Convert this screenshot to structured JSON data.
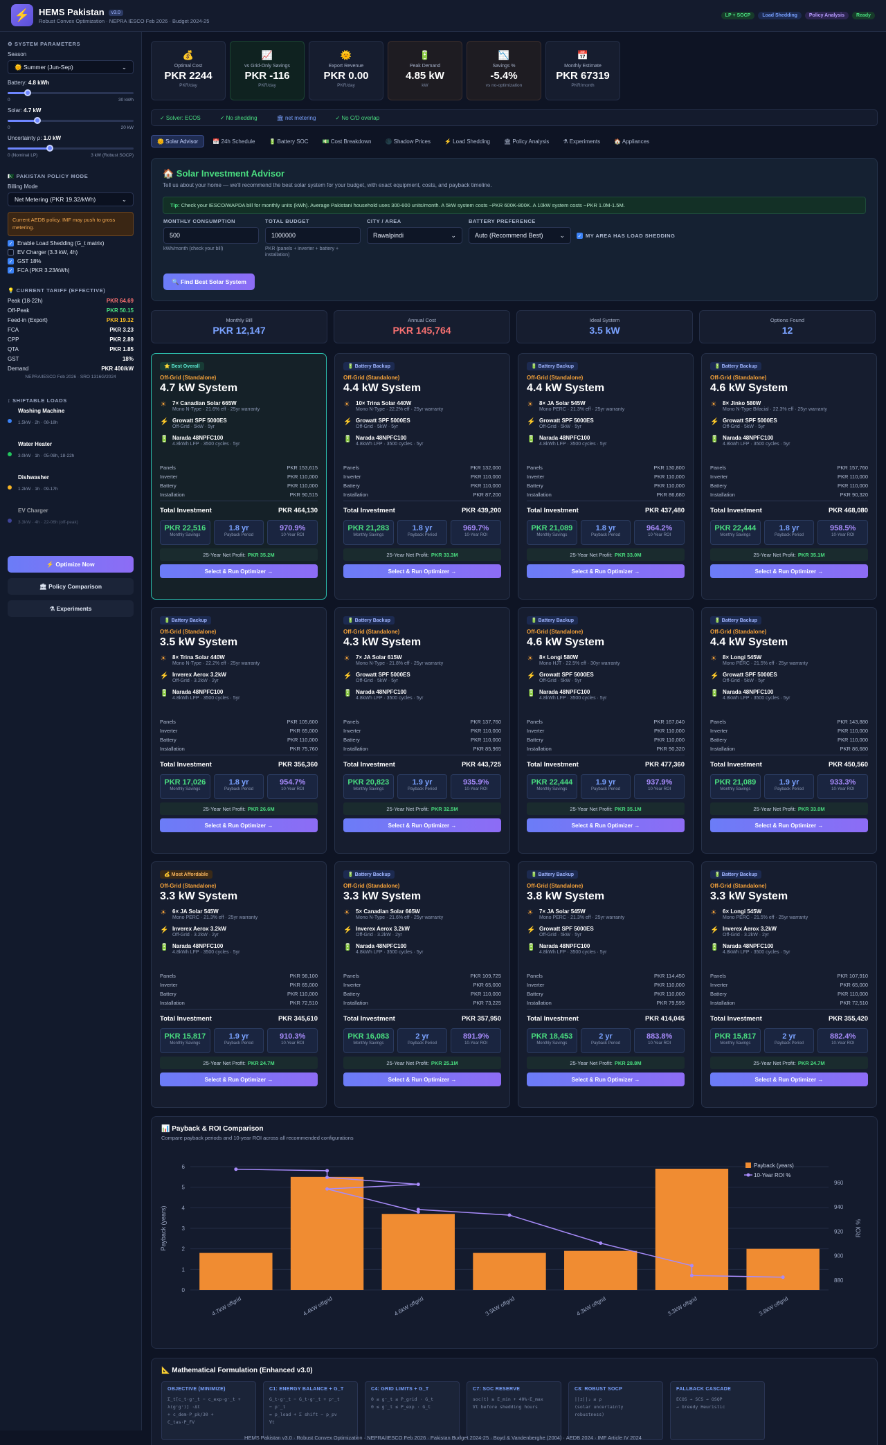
{
  "header": {
    "logo_glyph": "⚡",
    "title": "HEMS Pakistan",
    "version": "v3.0",
    "subtitle": "Robust Convex Optimization · NEPRA IESCO Feb 2026 · Budget 2024-25",
    "badges": [
      "LP + SOCP",
      "Load Shedding",
      "Policy Analysis",
      "Ready"
    ]
  },
  "sidebar": {
    "params_title": "⚙ SYSTEM PARAMETERS",
    "season_label": "Season",
    "season_value": "🌞 Summer (Jun-Sep)",
    "battery_label": "Battery:",
    "battery_value": "4.8 kWh",
    "battery_min": "0",
    "battery_max": "30 kWh",
    "battery_level": 0.16,
    "solar_label": "Solar:",
    "solar_value": "4.7 kW",
    "solar_min": "0",
    "solar_max": "20 kW",
    "solar_level": 0.235,
    "unc_label": "Uncertainty ρ:",
    "unc_value": "1.0 kW",
    "unc_min": "0 (Nominal LP)",
    "unc_max": "3 kW (Robust SOCP)",
    "unc_level": 0.333,
    "policy_title": "🇵🇰 PAKISTAN POLICY MODE",
    "billing_label": "Billing Mode",
    "billing_value": "Net Metering (PKR 19.32/kWh)",
    "warning": "Current AEDB policy. IMF may push to gross metering.",
    "checks": [
      {
        "label": "Enable Load Shedding (G_t matrix)",
        "on": true
      },
      {
        "label": "EV Charger (3.3 kW, 4h)",
        "on": false
      },
      {
        "label": "GST 18%",
        "on": true
      },
      {
        "label": "FCA (PKR 3.23/kWh)",
        "on": true
      }
    ],
    "tariff_title": "💡 CURRENT TARIFF (EFFECTIVE)",
    "tariff": [
      {
        "name": "Peak (18-22h)",
        "value": "PKR 64.69",
        "color": "#f87171"
      },
      {
        "name": "Off-Peak",
        "value": "PKR 50.15",
        "color": "#4ade80"
      },
      {
        "name": "Feed-in (Export)",
        "value": "PKR 19.32",
        "color": "#fbbf24"
      },
      {
        "name": "FCA",
        "value": "PKR 3.23",
        "color": "#ffffff"
      },
      {
        "name": "CPP",
        "value": "PKR 2.89",
        "color": "#ffffff"
      },
      {
        "name": "QTA",
        "value": "PKR 1.85",
        "color": "#ffffff"
      },
      {
        "name": "GST",
        "value": "18%",
        "color": "#ffffff"
      },
      {
        "name": "Demand",
        "value": "PKR 400/kW",
        "color": "#ffffff"
      }
    ],
    "tariff_note": "NEPRA/IESCO Feb 2026 · SRO 1316G/2024",
    "loads_title": "↕ SHIFTABLE LOADS",
    "loads": [
      {
        "name": "Washing Machine",
        "meta": "1.5kW · 2h · 08-18h",
        "color": "#3b82f6"
      },
      {
        "name": "Water Heater",
        "meta": "3.0kW · 1h · 05-08h, 18-22h",
        "color": "#22c55e"
      },
      {
        "name": "Dishwasher",
        "meta": "1.2kW · 1h · 09-17h",
        "color": "#f5b324"
      },
      {
        "name": "EV Charger",
        "meta": "3.3kW · 4h · 22-06h (off-peak)",
        "color": "#6366f1"
      }
    ],
    "optimize_btn": "⚡ Optimize Now",
    "policy_btn": "🏛 Policy Comparison",
    "experiments_btn": "⚗ Experiments"
  },
  "kpis": [
    {
      "icon": "💰",
      "label": "Optimal Cost",
      "value": "PKR 2244",
      "sub": "PKR/day",
      "color": "#ffffff"
    },
    {
      "icon": "📈",
      "label": "vs Grid-Only Savings",
      "value": "PKR -116",
      "sub": "PKR/day",
      "color": "#ffffff"
    },
    {
      "icon": "🌞",
      "label": "Export Revenue",
      "value": "PKR 0.00",
      "sub": "PKR/day",
      "color": "#ffffff"
    },
    {
      "icon": "🔋",
      "label": "Peak Demand",
      "value": "4.85 kW",
      "sub": "kW",
      "color": "#ffffff"
    },
    {
      "icon": "📉",
      "label": "Savings %",
      "value": "-5.4%",
      "sub": "vs no-optimization",
      "color": "#ffffff"
    },
    {
      "icon": "📅",
      "label": "Monthly Estimate",
      "value": "PKR 67319",
      "sub": "PKR/month",
      "color": "#ffffff"
    }
  ],
  "status": [
    "✓ Solver: ECOS",
    "✓ No shedding",
    "🏛 net metering",
    "✓ No C/D overlap"
  ],
  "tabs": [
    "🌞 Solar Advisor",
    "📅 24h Schedule",
    "🔋 Battery SOC",
    "💵 Cost Breakdown",
    "🌑 Shadow Prices",
    "⚡ Load Shedding",
    "🏛 Policy Analysis",
    "⚗ Experiments",
    "🏠 Appliances"
  ],
  "advisor": {
    "title": "🏠 Solar Investment Advisor",
    "subtitle": "Tell us about your home — we'll recommend the best solar system for your budget, with exact equipment, costs, and payback timeline.",
    "tip_label": "Tip:",
    "tip_text": "Check your IESCO/WAPDA bill for monthly units (kWh). Average Pakistani household uses 300-600 units/month. A 5kW system costs ~PKR 600K-800K. A 10kW system costs ~PKR 1.0M-1.5M.",
    "consumption_label": "MONTHLY CONSUMPTION",
    "consumption_value": "500",
    "consumption_help": "kWh/month (check your bill)",
    "budget_label": "TOTAL BUDGET",
    "budget_value": "1000000",
    "budget_help": "PKR (panels + inverter + battery + installation)",
    "city_label": "CITY / AREA",
    "city_value": "Rawalpindi",
    "battery_label": "BATTERY PREFERENCE",
    "battery_value": "Auto (Recommend Best)",
    "shedding_label": "MY AREA HAS LOAD SHEDDING",
    "find_btn": "🔍 Find Best Solar System"
  },
  "summary": [
    {
      "label": "Monthly Bill",
      "value": "PKR 12,147",
      "color": "#7aa2ff"
    },
    {
      "label": "Annual Cost",
      "value": "PKR 145,764",
      "color": "#f87171"
    },
    {
      "label": "Ideal System",
      "value": "3.5 kW",
      "color": "#7aa2ff"
    },
    {
      "label": "Options Found",
      "value": "12",
      "color": "#7aa2ff"
    }
  ],
  "card_labels": {
    "panels": "Panels",
    "inverter": "Inverter",
    "battery": "Battery",
    "installation": "Installation",
    "total": "Total Investment",
    "monthly": "Monthly Savings",
    "payback": "Payback Period",
    "roi": "10-Year ROI",
    "net": "25-Year Net Profit:",
    "select": "Select & Run Optimizer →"
  },
  "cards": [
    {
      "badge": "⭐ Best Overall",
      "kind": "best",
      "type": "Off-Grid (Standalone)",
      "system": "4.7 kW System",
      "panel": "7× Canadian Solar 665W",
      "panel_spec": "Mono N-Type · 21.6% eff · 25yr warranty",
      "inverter": "Growatt SPF 5000ES",
      "inverter_spec": "Off-Grid · 5kW · 5yr",
      "battery": "Narada 48NPFC100",
      "battery_spec": "4.8kWh LFP · 3500 cycles · 5yr",
      "c_panels": "PKR 153,615",
      "c_inverter": "PKR 110,000",
      "c_battery": "PKR 110,000",
      "c_install": "PKR 90,515",
      "total": "PKR 464,130",
      "monthly": "PKR 22,516",
      "payback": "1.8 yr",
      "roi": "970.9%",
      "net": "PKR 35.2M"
    },
    {
      "badge": "🔋 Battery Backup",
      "kind": "bb",
      "type": "Off-Grid (Standalone)",
      "system": "4.4 kW System",
      "panel": "10× Trina Solar 440W",
      "panel_spec": "Mono N-Type · 22.2% eff · 25yr warranty",
      "inverter": "Growatt SPF 5000ES",
      "inverter_spec": "Off-Grid · 5kW · 5yr",
      "battery": "Narada 48NPFC100",
      "battery_spec": "4.8kWh LFP · 3500 cycles · 5yr",
      "c_panels": "PKR 132,000",
      "c_inverter": "PKR 110,000",
      "c_battery": "PKR 110,000",
      "c_install": "PKR 87,200",
      "total": "PKR 439,200",
      "monthly": "PKR 21,283",
      "payback": "1.8 yr",
      "roi": "969.7%",
      "net": "PKR 33.3M"
    },
    {
      "badge": "🔋 Battery Backup",
      "kind": "bb",
      "type": "Off-Grid (Standalone)",
      "system": "4.4 kW System",
      "panel": "8× JA Solar 545W",
      "panel_spec": "Mono PERC · 21.3% eff · 25yr warranty",
      "inverter": "Growatt SPF 5000ES",
      "inverter_spec": "Off-Grid · 5kW · 5yr",
      "battery": "Narada 48NPFC100",
      "battery_spec": "4.8kWh LFP · 3500 cycles · 5yr",
      "c_panels": "PKR 130,800",
      "c_inverter": "PKR 110,000",
      "c_battery": "PKR 110,000",
      "c_install": "PKR 86,680",
      "total": "PKR 437,480",
      "monthly": "PKR 21,089",
      "payback": "1.8 yr",
      "roi": "964.2%",
      "net": "PKR 33.0M"
    },
    {
      "badge": "🔋 Battery Backup",
      "kind": "bb",
      "type": "Off-Grid (Standalone)",
      "system": "4.6 kW System",
      "panel": "8× Jinko 580W",
      "panel_spec": "Mono N-Type Bifacial · 22.3% eff · 25yr warranty",
      "inverter": "Growatt SPF 5000ES",
      "inverter_spec": "Off-Grid · 5kW · 5yr",
      "battery": "Narada 48NPFC100",
      "battery_spec": "4.8kWh LFP · 3500 cycles · 5yr",
      "c_panels": "PKR 157,760",
      "c_inverter": "PKR 110,000",
      "c_battery": "PKR 110,000",
      "c_install": "PKR 90,320",
      "total": "PKR 468,080",
      "monthly": "PKR 22,444",
      "payback": "1.8 yr",
      "roi": "958.5%",
      "net": "PKR 35.1M"
    },
    {
      "badge": "🔋 Battery Backup",
      "kind": "bb",
      "type": "Off-Grid (Standalone)",
      "system": "3.5 kW System",
      "panel": "8× Trina Solar 440W",
      "panel_spec": "Mono N-Type · 22.2% eff · 25yr warranty",
      "inverter": "Inverex Aerox 3.2kW",
      "inverter_spec": "Off-Grid · 3.2kW · 2yr",
      "battery": "Narada 48NPFC100",
      "battery_spec": "4.8kWh LFP · 3500 cycles · 5yr",
      "c_panels": "PKR 105,600",
      "c_inverter": "PKR 65,000",
      "c_battery": "PKR 110,000",
      "c_install": "PKR 75,760",
      "total": "PKR 356,360",
      "monthly": "PKR 17,026",
      "payback": "1.8 yr",
      "roi": "954.7%",
      "net": "PKR 26.6M"
    },
    {
      "badge": "🔋 Battery Backup",
      "kind": "bb",
      "type": "Off-Grid (Standalone)",
      "system": "4.3 kW System",
      "panel": "7× JA Solar 615W",
      "panel_spec": "Mono N-Type · 21.8% eff · 25yr warranty",
      "inverter": "Growatt SPF 5000ES",
      "inverter_spec": "Off-Grid · 5kW · 5yr",
      "battery": "Narada 48NPFC100",
      "battery_spec": "4.8kWh LFP · 3500 cycles · 5yr",
      "c_panels": "PKR 137,760",
      "c_inverter": "PKR 110,000",
      "c_battery": "PKR 110,000",
      "c_install": "PKR 85,965",
      "total": "PKR 443,725",
      "monthly": "PKR 20,823",
      "payback": "1.9 yr",
      "roi": "935.9%",
      "net": "PKR 32.5M"
    },
    {
      "badge": "🔋 Battery Backup",
      "kind": "bb",
      "type": "Off-Grid (Standalone)",
      "system": "4.6 kW System",
      "panel": "8× Longi 580W",
      "panel_spec": "Mono HJT · 22.5% eff · 30yr warranty",
      "inverter": "Growatt SPF 5000ES",
      "inverter_spec": "Off-Grid · 5kW · 5yr",
      "battery": "Narada 48NPFC100",
      "battery_spec": "4.8kWh LFP · 3500 cycles · 5yr",
      "c_panels": "PKR 167,040",
      "c_inverter": "PKR 110,000",
      "c_battery": "PKR 110,000",
      "c_install": "PKR 90,320",
      "total": "PKR 477,360",
      "monthly": "PKR 22,444",
      "payback": "1.9 yr",
      "roi": "937.9%",
      "net": "PKR 35.1M"
    },
    {
      "badge": "🔋 Battery Backup",
      "kind": "bb",
      "type": "Off-Grid (Standalone)",
      "system": "4.4 kW System",
      "panel": "8× Longi 545W",
      "panel_spec": "Mono PERC · 21.5% eff · 25yr warranty",
      "inverter": "Growatt SPF 5000ES",
      "inverter_spec": "Off-Grid · 5kW · 5yr",
      "battery": "Narada 48NPFC100",
      "battery_spec": "4.8kWh LFP · 3500 cycles · 5yr",
      "c_panels": "PKR 143,880",
      "c_inverter": "PKR 110,000",
      "c_battery": "PKR 110,000",
      "c_install": "PKR 86,680",
      "total": "PKR 450,560",
      "monthly": "PKR 21,089",
      "payback": "1.9 yr",
      "roi": "933.3%",
      "net": "PKR 33.0M"
    },
    {
      "badge": "💰 Most Affordable",
      "kind": "aff",
      "type": "Off-Grid (Standalone)",
      "system": "3.3 kW System",
      "panel": "6× JA Solar 545W",
      "panel_spec": "Mono PERC · 21.3% eff · 25yr warranty",
      "inverter": "Inverex Aerox 3.2kW",
      "inverter_spec": "Off-Grid · 3.2kW · 2yr",
      "battery": "Narada 48NPFC100",
      "battery_spec": "4.8kWh LFP · 3500 cycles · 5yr",
      "c_panels": "PKR 98,100",
      "c_inverter": "PKR 65,000",
      "c_battery": "PKR 110,000",
      "c_install": "PKR 72,510",
      "total": "PKR 345,610",
      "monthly": "PKR 15,817",
      "payback": "1.9 yr",
      "roi": "910.3%",
      "net": "PKR 24.7M"
    },
    {
      "badge": "🔋 Battery Backup",
      "kind": "bb",
      "type": "Off-Grid (Standalone)",
      "system": "3.3 kW System",
      "panel": "5× Canadian Solar 665W",
      "panel_spec": "Mono N-Type · 21.6% eff · 25yr warranty",
      "inverter": "Inverex Aerox 3.2kW",
      "inverter_spec": "Off-Grid · 3.2kW · 2yr",
      "battery": "Narada 48NPFC100",
      "battery_spec": "4.8kWh LFP · 3500 cycles · 5yr",
      "c_panels": "PKR 109,725",
      "c_inverter": "PKR 65,000",
      "c_battery": "PKR 110,000",
      "c_install": "PKR 73,225",
      "total": "PKR 357,950",
      "monthly": "PKR 16,083",
      "payback": "2 yr",
      "roi": "891.9%",
      "net": "PKR 25.1M"
    },
    {
      "badge": "🔋 Battery Backup",
      "kind": "bb",
      "type": "Off-Grid (Standalone)",
      "system": "3.8 kW System",
      "panel": "7× JA Solar 545W",
      "panel_spec": "Mono PERC · 21.3% eff · 25yr warranty",
      "inverter": "Growatt SPF 5000ES",
      "inverter_spec": "Off-Grid · 5kW · 5yr",
      "battery": "Narada 48NPFC100",
      "battery_spec": "4.8kWh LFP · 3500 cycles · 5yr",
      "c_panels": "PKR 114,450",
      "c_inverter": "PKR 110,000",
      "c_battery": "PKR 110,000",
      "c_install": "PKR 79,595",
      "total": "PKR 414,045",
      "monthly": "PKR 18,453",
      "payback": "2 yr",
      "roi": "883.8%",
      "net": "PKR 28.8M"
    },
    {
      "badge": "🔋 Battery Backup",
      "kind": "bb",
      "type": "Off-Grid (Standalone)",
      "system": "3.3 kW System",
      "panel": "6× Longi 545W",
      "panel_spec": "Mono PERC · 21.5% eff · 25yr warranty",
      "inverter": "Inverex Aerox 3.2kW",
      "inverter_spec": "Off-Grid · 3.2kW · 2yr",
      "battery": "Narada 48NPFC100",
      "battery_spec": "4.8kWh LFP · 3500 cycles · 5yr",
      "c_panels": "PKR 107,910",
      "c_inverter": "PKR 65,000",
      "c_battery": "PKR 110,000",
      "c_install": "PKR 72,510",
      "total": "PKR 355,420",
      "monthly": "PKR 15,817",
      "payback": "2 yr",
      "roi": "882.4%",
      "net": "PKR 24.7M"
    }
  ],
  "chart_section": {
    "title": "📊 Payback & ROI Comparison",
    "subtitle": "Compare payback periods and 10-year ROI across all recommended configurations"
  },
  "chart_data": {
    "type": "bar",
    "title": "",
    "categories": [
      "4.7kW offgrid",
      "4.4kW offgrid",
      "4.6kW offgrid",
      "3.5kW offgrid",
      "4.3kW offgrid",
      "3.3kW offgrid",
      "3.8kW offgrid"
    ],
    "series": [
      {
        "name": "Payback (years)",
        "type": "bar",
        "axis": "left",
        "color": "#f08c32",
        "values": [
          1.8,
          5.5,
          3.7,
          1.8,
          1.9,
          5.9,
          2.0
        ]
      },
      {
        "name": "10-Year ROI %",
        "type": "line",
        "axis": "right",
        "color": "#a78bfa",
        "points": [
          [
            0,
            970.9
          ],
          [
            1,
            969.7
          ],
          [
            1,
            964.2
          ],
          [
            2,
            958.5
          ],
          [
            1,
            954.7
          ],
          [
            2,
            935.9
          ],
          [
            2,
            937.9
          ],
          [
            3,
            933.3
          ],
          [
            4,
            910.3
          ],
          [
            5,
            891.9
          ],
          [
            5,
            883.8
          ],
          [
            6,
            882.4
          ]
        ]
      }
    ],
    "ylabel": "Payback (years)",
    "y2label": "ROI %",
    "ylim": [
      0,
      6
    ],
    "y2lim": [
      872,
      973
    ],
    "yticks": [
      0,
      1,
      2,
      3,
      4,
      5,
      6
    ],
    "y2ticks": [
      880,
      900,
      920,
      940,
      960
    ],
    "grid": true,
    "legend": "top-right"
  },
  "math": {
    "title": "📐 Mathematical Formulation (Enhanced v3.0)",
    "cards": [
      {
        "title": "OBJECTIVE (MINIMIZE)",
        "text": "Σ_t[c_t·g⁺_t − c_exp·g⁻_t +\nλ(g⁺g⁺)] ·Δt\n+ c_dem·P_pk/30 +\nC_tas·P_FV"
      },
      {
        "title": "C1: ENERGY BALANCE + G_T",
        "text": "G_t·g⁺_t − G_t·g⁺_t + p⁺_t\n− p⁻_t\n= p_load + Σ shift − p_pv\n∀t"
      },
      {
        "title": "C4: GRID LIMITS + G_T",
        "text": "0 ≤ g⁺_t ≤ P_grid · G_t\n0 ≤ g⁻_t ≤ P_exp · G_t"
      },
      {
        "title": "C7: SOC RESERVE",
        "text": "soc(t) ≥ E_min + 40%·E_max\n∀t before shedding hours"
      },
      {
        "title": "C8: ROBUST SOCP",
        "text": "||z||₂ ≤ ρ\n(solar uncertainty\nrobustness)"
      },
      {
        "title": "FALLBACK CASCADE",
        "text": "ECOS → SCS → OSQP\n→ Greedy Heuristic"
      }
    ]
  },
  "footer": "HEMS Pakistan v3.0 · Robust Convex Optimization · NEPRA/IESCO Feb 2026 · Pakistan Budget 2024-25 · Boyd & Vandenberghe (2004) · AEDB 2024 · IMF Article IV 2024"
}
